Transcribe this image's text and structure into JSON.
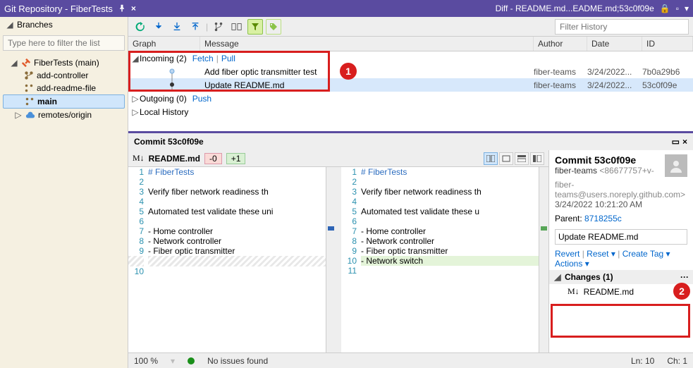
{
  "title": "Git Repository - FiberTests",
  "diff_title": "Diff - README.md...EADME.md;53c0f09e",
  "sidebar": {
    "heading": "Branches",
    "filter_placeholder": "Type here to filter the list",
    "repo": "FiberTests (main)",
    "branches": [
      "add-controller",
      "add-readme-file",
      "main"
    ],
    "remote": "remotes/origin"
  },
  "filter_history_placeholder": "Filter History",
  "grid": {
    "graph": "Graph",
    "message": "Message",
    "author": "Author",
    "date": "Date",
    "id": "ID"
  },
  "history": {
    "incoming_label": "Incoming (2)",
    "fetch": "Fetch",
    "pull": "Pull",
    "push": "Push",
    "outgoing_label": "Outgoing (0)",
    "local": "Local History",
    "rows": [
      {
        "msg": "Add fiber optic transmitter test",
        "author": "fiber-teams",
        "date": "3/24/2022...",
        "id": "7b0a29b6"
      },
      {
        "msg": "Update README.md",
        "author": "fiber-teams",
        "date": "3/24/2022...",
        "id": "53c0f09e"
      }
    ]
  },
  "commit_header": "Commit 53c0f09e",
  "diff_file": "README.md",
  "del_count": "-0",
  "add_count": "+1",
  "left_lines": {
    "1": "# FiberTests",
    "2": " ",
    "3": "Verify fiber network readiness th",
    "4": " ",
    "5": "Automated test validate these uni",
    "6": " ",
    "7": "- Home controller",
    "8": "- Network controller",
    "9": "- Fiber optic transmitter",
    "10": " "
  },
  "right_lines": {
    "1": "# FiberTests",
    "2": " ",
    "3": "Verify fiber network readiness th",
    "4": " ",
    "5": "Automated test validate these u",
    "6": " ",
    "7": "- Home controller",
    "8": "- Network controller",
    "9": "- Fiber optic transmitter",
    "10": "- Network switch",
    "11": " "
  },
  "commit_panel": {
    "title": "Commit 53c0f09e",
    "author": "fiber-teams",
    "author_suffix": "<86677757+v-",
    "email": "fiber-teams@users.noreply.github.com>",
    "date": "3/24/2022 10:21:20 AM",
    "parent_label": "Parent:",
    "parent": "8718255c",
    "message": "Update README.md",
    "revert": "Revert",
    "reset": "Reset",
    "create_tag": "Create Tag",
    "actions": "Actions",
    "changes": "Changes (1)",
    "file": "README.md",
    "mod": "M",
    "ellipsis": "···"
  },
  "status": {
    "zoom": "100 %",
    "issues": "No issues found",
    "ln": "Ln: 10",
    "ch": "Ch: 1"
  },
  "badges": {
    "b1": "1",
    "b2": "2"
  }
}
